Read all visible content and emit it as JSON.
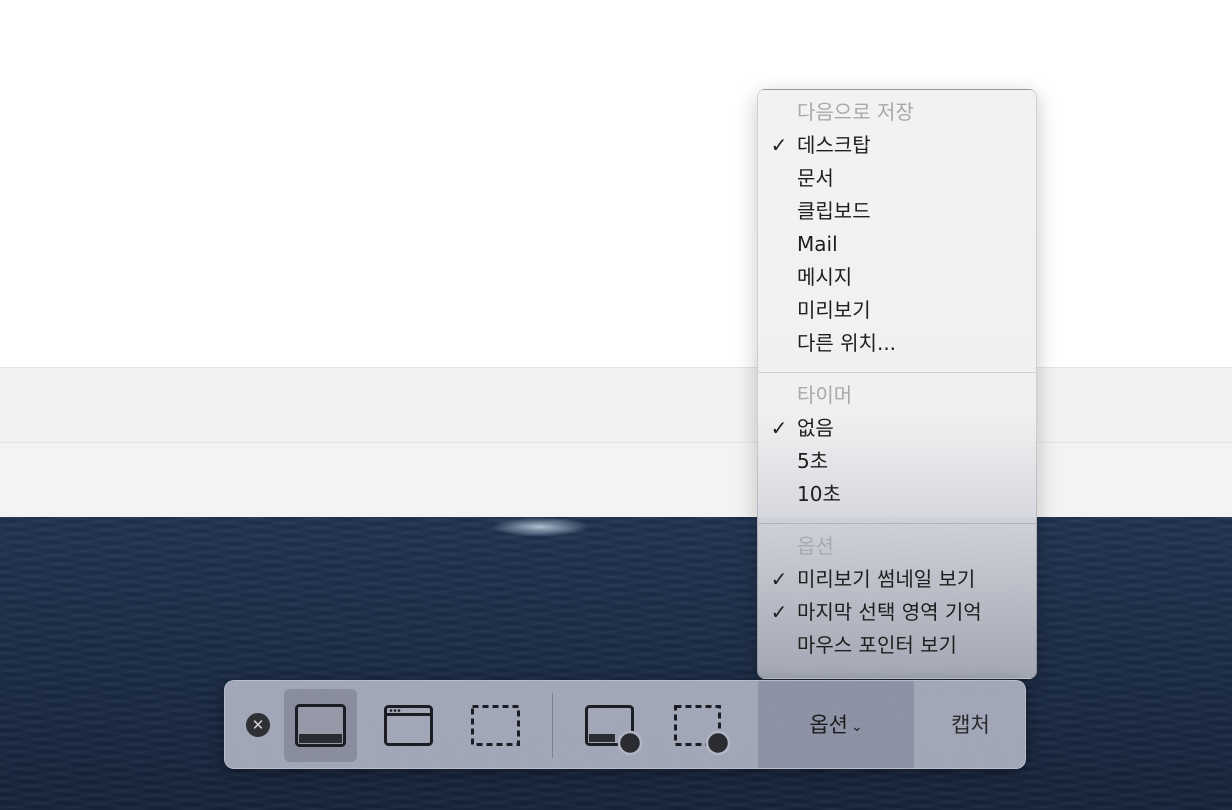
{
  "menu": {
    "save_section": {
      "header": "다음으로 저장",
      "items": [
        {
          "label": "데스크탑",
          "checked": true
        },
        {
          "label": "문서",
          "checked": false
        },
        {
          "label": "클립보드",
          "checked": false
        },
        {
          "label": "Mail",
          "checked": false
        },
        {
          "label": "메시지",
          "checked": false
        },
        {
          "label": "미리보기",
          "checked": false
        },
        {
          "label": "다른 위치...",
          "checked": false
        }
      ]
    },
    "timer_section": {
      "header": "타이머",
      "items": [
        {
          "label": "없음",
          "checked": true
        },
        {
          "label": "5초",
          "checked": false
        },
        {
          "label": "10초",
          "checked": false
        }
      ]
    },
    "options_section": {
      "header": "옵션",
      "items": [
        {
          "label": "미리보기 썸네일 보기",
          "checked": true
        },
        {
          "label": "마지막 선택 영역 기억",
          "checked": true
        },
        {
          "label": "마우스 포인터 보기",
          "checked": false
        }
      ]
    },
    "check_glyph": "✓"
  },
  "toolbar": {
    "close_glyph": "✕",
    "options_label": "옵션",
    "options_chevron": "⌄",
    "capture_label": "캡처",
    "icons": [
      {
        "name": "capture-entire-screen-icon",
        "selected": true
      },
      {
        "name": "capture-window-icon",
        "selected": false
      },
      {
        "name": "capture-selection-icon",
        "selected": false
      },
      {
        "name": "record-entire-screen-icon",
        "selected": false
      },
      {
        "name": "record-selection-icon",
        "selected": false
      }
    ]
  },
  "colors": {
    "menu_header": "#a9a9ad",
    "menu_text": "#1e1e1e",
    "ocean": "#1a2b46",
    "toolbar": "#aeb2c2"
  }
}
